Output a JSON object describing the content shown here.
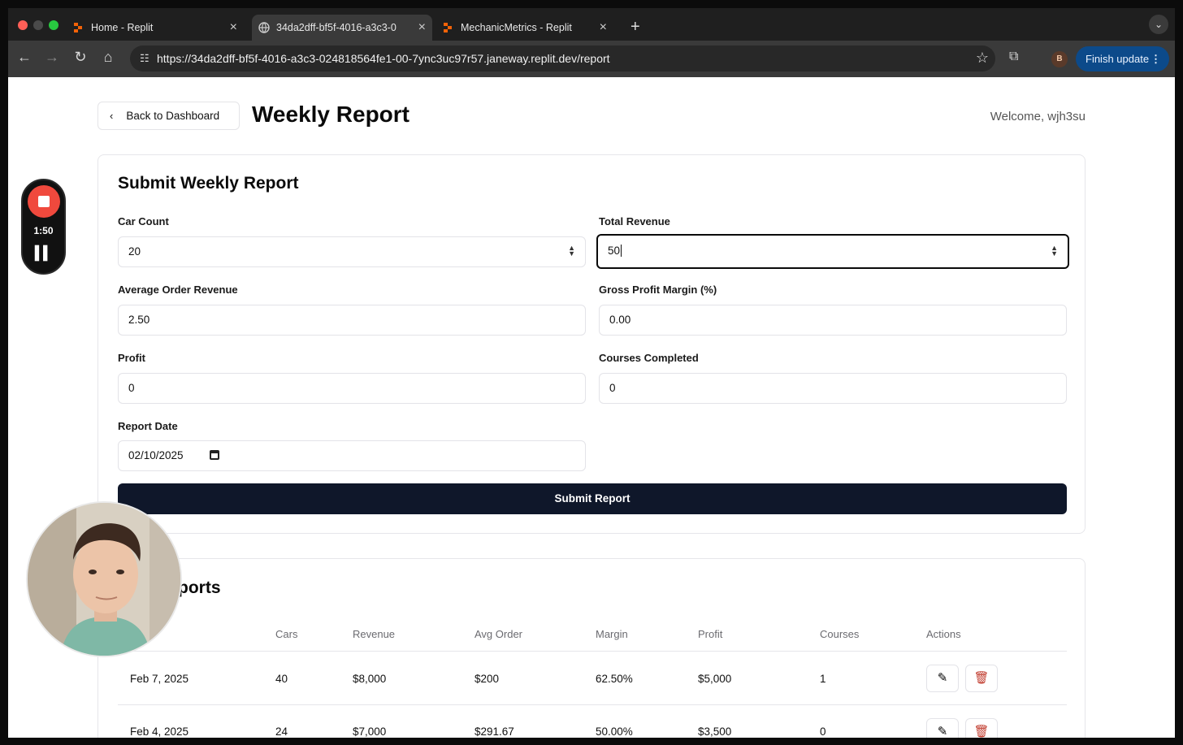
{
  "browser": {
    "tabs": [
      {
        "title": "Home - Replit"
      },
      {
        "title": "34da2dff-bf5f-4016-a3c3-0"
      },
      {
        "title": "MechanicMetrics - Replit"
      }
    ],
    "new_tab": "+",
    "url": "https://34da2dff-bf5f-4016-a3c3-024818564fe1-00-7ync3uc97r57.janeway.replit.dev/report",
    "profile_initial": "B",
    "finish_update": "Finish update"
  },
  "header": {
    "back_label": "Back to Dashboard",
    "title": "Weekly Report",
    "welcome": "Welcome, wjh3su"
  },
  "form": {
    "title": "Submit Weekly Report",
    "car_count": {
      "label": "Car Count",
      "value": "20"
    },
    "total_revenue": {
      "label": "Total Revenue",
      "value": "50"
    },
    "avg_order_revenue": {
      "label": "Average Order Revenue",
      "value": "2.50"
    },
    "gross_profit_margin": {
      "label": "Gross Profit Margin (%)",
      "value": "0.00"
    },
    "profit": {
      "label": "Profit",
      "value": "0"
    },
    "courses_completed": {
      "label": "Courses Completed",
      "value": "0"
    },
    "report_date": {
      "label": "Report Date",
      "value": "02/10/2025"
    },
    "submit_label": "Submit Report"
  },
  "reports": {
    "title_partial": "ports",
    "columns": [
      "Cars",
      "Revenue",
      "Avg Order",
      "Margin",
      "Profit",
      "Courses",
      "Actions"
    ],
    "rows": [
      {
        "date": "Feb 7, 2025",
        "cars": "40",
        "revenue": "$8,000",
        "avg_order": "$200",
        "margin": "62.50%",
        "profit": "$5,000",
        "courses": "1"
      },
      {
        "date": "Feb 4, 2025",
        "cars": "24",
        "revenue": "$7,000",
        "avg_order": "$291.67",
        "margin": "50.00%",
        "profit": "$3,500",
        "courses": "0"
      }
    ]
  },
  "recorder": {
    "time": "1:50"
  },
  "colors": {
    "primary": "#0f172a",
    "finish_button": "#0c4a8a",
    "record": "#f0493d",
    "delete": "#c0392b"
  }
}
